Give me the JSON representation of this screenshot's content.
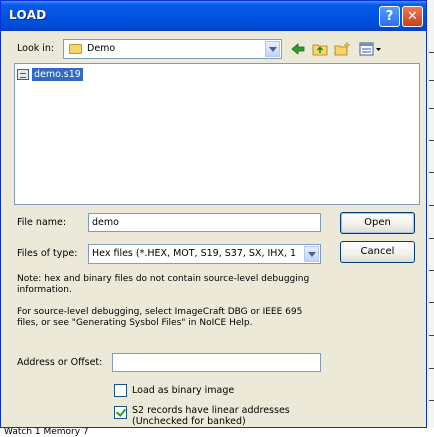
{
  "window": {
    "title": "LOAD",
    "help_label": "?",
    "close_label": "✕"
  },
  "toolbar": {
    "look_in_label": "Look in:",
    "look_in_value": "Demo",
    "icons": [
      "back-arrow-icon",
      "up-folder-icon",
      "new-folder-icon",
      "view-menu-icon"
    ]
  },
  "files": [
    {
      "name": "demo.s19",
      "selected": true
    }
  ],
  "form": {
    "file_name_label": "File name:",
    "file_name_value": "demo",
    "files_of_type_label": "Files of type:",
    "files_of_type_value": "Hex files (*.HEX, MOT, S19, S37, SX, IHX, 1",
    "address_label": "Address or Offset:",
    "address_value": ""
  },
  "buttons": {
    "open": "Open",
    "cancel": "Cancel"
  },
  "notes": {
    "note1_line1": "Note: hex and binary files do not contain source-level debugging",
    "note1_line2": "information.",
    "note2_line1": "For source-level debugging, select ImageCraft DBG or IEEE 695",
    "note2_line2": "files, or see \"Generating Sysbol Files\" in NoICE Help."
  },
  "options": {
    "load_binary": {
      "label": "Load as binary image",
      "checked": false
    },
    "s2_linear": {
      "label_line1": "S2 records have linear addresses",
      "label_line2": "(Unchecked for banked)",
      "checked": true
    }
  },
  "background": {
    "bottom_text": "Watch 1  Memory 7"
  }
}
